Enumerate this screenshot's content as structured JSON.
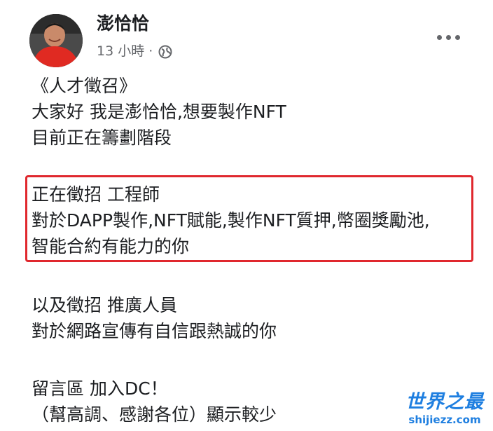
{
  "post": {
    "author": "澎恰恰",
    "timestamp": "13 小時 ·",
    "privacy_icon": "globe-icon",
    "more_icon": "more-horizontal-icon",
    "lines_intro": [
      "《人才徵召》",
      "大家好 我是澎恰恰,想要製作NFT",
      "目前正在籌劃階段"
    ],
    "lines_highlight": [
      "正在徵招 工程師",
      "對於DAPP製作,NFT賦能,製作NFT質押,幣圈獎勵池,",
      "智能合約有能力的你"
    ],
    "lines_promoter": [
      "以及徵招 推廣人員",
      "對於網路宣傳有自信跟熱誠的你"
    ],
    "lines_footer": [
      "留言區 加入DC！",
      "（幫高調、感謝各位）顯示較少"
    ],
    "highlight_color": "#e0282e"
  },
  "watermark": {
    "title": "世界之最",
    "url": "shijiezz.com",
    "color": "#1f7fe0"
  }
}
